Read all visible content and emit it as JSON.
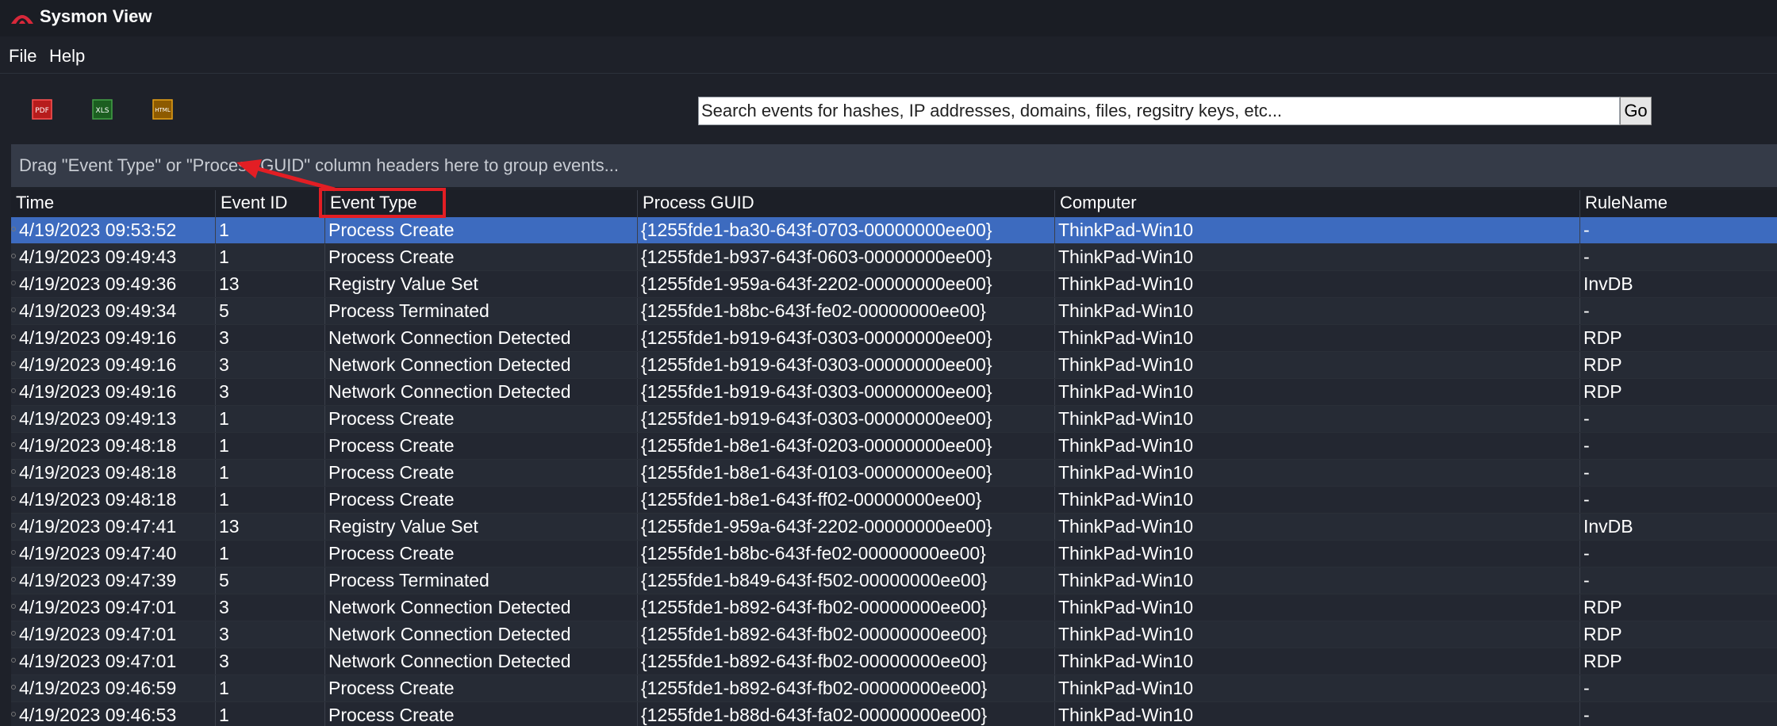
{
  "app": {
    "title": "Sysmon View",
    "icon": "sysmon-logo-icon"
  },
  "menu": {
    "items": [
      "File",
      "Help"
    ]
  },
  "toolbar": {
    "buttons": [
      {
        "name": "export-pdf-button",
        "icon": "pdf-icon",
        "label": "PDF",
        "color": "#d32f2f"
      },
      {
        "name": "export-xls-button",
        "icon": "xls-icon",
        "label": "XLS",
        "color": "#2e7d32"
      },
      {
        "name": "export-html-button",
        "icon": "html-icon",
        "label": "HTML",
        "color": "#e6a117"
      }
    ]
  },
  "search": {
    "placeholder": "Search events for hashes, IP addresses, domains, files, regsitry keys, etc...",
    "value": "",
    "go_label": "Go"
  },
  "group_panel": {
    "text": "Drag \"Event Type\" or \"Process GUID\" column headers here to group events..."
  },
  "grid": {
    "columns": [
      "Time",
      "Event ID",
      "Event Type",
      "Process GUID",
      "Computer",
      "RuleName"
    ],
    "selected_row": 0,
    "rows": [
      [
        "4/19/2023 09:53:52",
        "1",
        "Process Create",
        "{1255fde1-ba30-643f-0703-00000000ee00}",
        "ThinkPad-Win10",
        "-"
      ],
      [
        "4/19/2023 09:49:43",
        "1",
        "Process Create",
        "{1255fde1-b937-643f-0603-00000000ee00}",
        "ThinkPad-Win10",
        "-"
      ],
      [
        "4/19/2023 09:49:36",
        "13",
        "Registry Value Set",
        "{1255fde1-959a-643f-2202-00000000ee00}",
        "ThinkPad-Win10",
        "InvDB"
      ],
      [
        "4/19/2023 09:49:34",
        "5",
        "Process Terminated",
        "{1255fde1-b8bc-643f-fe02-00000000ee00}",
        "ThinkPad-Win10",
        "-"
      ],
      [
        "4/19/2023 09:49:16",
        "3",
        "Network Connection Detected",
        "{1255fde1-b919-643f-0303-00000000ee00}",
        "ThinkPad-Win10",
        "RDP"
      ],
      [
        "4/19/2023 09:49:16",
        "3",
        "Network Connection Detected",
        "{1255fde1-b919-643f-0303-00000000ee00}",
        "ThinkPad-Win10",
        "RDP"
      ],
      [
        "4/19/2023 09:49:16",
        "3",
        "Network Connection Detected",
        "{1255fde1-b919-643f-0303-00000000ee00}",
        "ThinkPad-Win10",
        "RDP"
      ],
      [
        "4/19/2023 09:49:13",
        "1",
        "Process Create",
        "{1255fde1-b919-643f-0303-00000000ee00}",
        "ThinkPad-Win10",
        "-"
      ],
      [
        "4/19/2023 09:48:18",
        "1",
        "Process Create",
        "{1255fde1-b8e1-643f-0203-00000000ee00}",
        "ThinkPad-Win10",
        "-"
      ],
      [
        "4/19/2023 09:48:18",
        "1",
        "Process Create",
        "{1255fde1-b8e1-643f-0103-00000000ee00}",
        "ThinkPad-Win10",
        "-"
      ],
      [
        "4/19/2023 09:48:18",
        "1",
        "Process Create",
        "{1255fde1-b8e1-643f-ff02-00000000ee00}",
        "ThinkPad-Win10",
        "-"
      ],
      [
        "4/19/2023 09:47:41",
        "13",
        "Registry Value Set",
        "{1255fde1-959a-643f-2202-00000000ee00}",
        "ThinkPad-Win10",
        "InvDB"
      ],
      [
        "4/19/2023 09:47:40",
        "1",
        "Process Create",
        "{1255fde1-b8bc-643f-fe02-00000000ee00}",
        "ThinkPad-Win10",
        "-"
      ],
      [
        "4/19/2023 09:47:39",
        "5",
        "Process Terminated",
        "{1255fde1-b849-643f-f502-00000000ee00}",
        "ThinkPad-Win10",
        "-"
      ],
      [
        "4/19/2023 09:47:01",
        "3",
        "Network Connection Detected",
        "{1255fde1-b892-643f-fb02-00000000ee00}",
        "ThinkPad-Win10",
        "RDP"
      ],
      [
        "4/19/2023 09:47:01",
        "3",
        "Network Connection Detected",
        "{1255fde1-b892-643f-fb02-00000000ee00}",
        "ThinkPad-Win10",
        "RDP"
      ],
      [
        "4/19/2023 09:47:01",
        "3",
        "Network Connection Detected",
        "{1255fde1-b892-643f-fb02-00000000ee00}",
        "ThinkPad-Win10",
        "RDP"
      ],
      [
        "4/19/2023 09:46:59",
        "1",
        "Process Create",
        "{1255fde1-b892-643f-fb02-00000000ee00}",
        "ThinkPad-Win10",
        "-"
      ],
      [
        "4/19/2023 09:46:53",
        "1",
        "Process Create",
        "{1255fde1-b88d-643f-fa02-00000000ee00}",
        "ThinkPad-Win10",
        "-"
      ]
    ]
  },
  "annotation": {
    "highlight_color": "#e31e24"
  }
}
